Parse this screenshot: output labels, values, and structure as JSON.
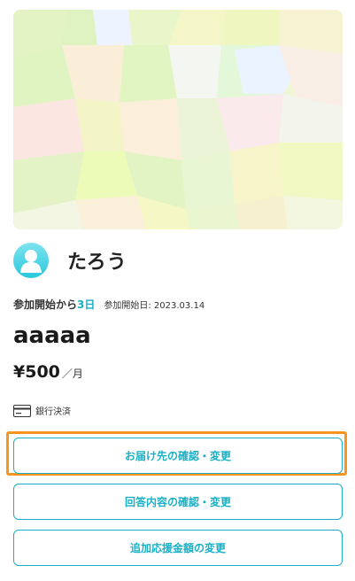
{
  "profile": {
    "name": "たろう"
  },
  "participation": {
    "since_label": "参加開始から",
    "days": "3日",
    "start_date_label": "参加開始日: 2023.03.14"
  },
  "plan": {
    "title": "aaaaa",
    "price": "¥500",
    "unit": "／月"
  },
  "payment": {
    "icon": "credit-card-icon",
    "method": "銀行決済"
  },
  "actions": [
    {
      "label": "お届け先の確認・変更",
      "highlighted": true
    },
    {
      "label": "回答内容の確認・変更",
      "highlighted": false
    },
    {
      "label": "追加応援金額の変更",
      "highlighted": false
    }
  ],
  "colors": {
    "accent": "#1aafc4",
    "highlight": "#f7951d"
  }
}
